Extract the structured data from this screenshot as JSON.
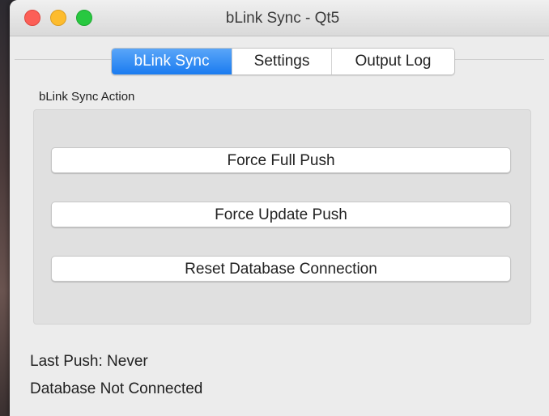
{
  "window": {
    "title": "bLink Sync - Qt5"
  },
  "tabs": [
    {
      "label": "bLink Sync",
      "active": true
    },
    {
      "label": "Settings",
      "active": false
    },
    {
      "label": "Output Log",
      "active": false
    }
  ],
  "sync_action": {
    "group_title": "bLink Sync Action",
    "buttons": [
      {
        "label": "Force Full Push"
      },
      {
        "label": "Force Update Push"
      },
      {
        "label": "Reset Database Connection"
      }
    ]
  },
  "status": {
    "last_push": "Last Push: Never",
    "database": "Database Not Connected"
  },
  "colors": {
    "active_tab": "#1a7bf0",
    "close": "#fc5f57",
    "minimize": "#fdbc2e",
    "zoom": "#28c840"
  }
}
